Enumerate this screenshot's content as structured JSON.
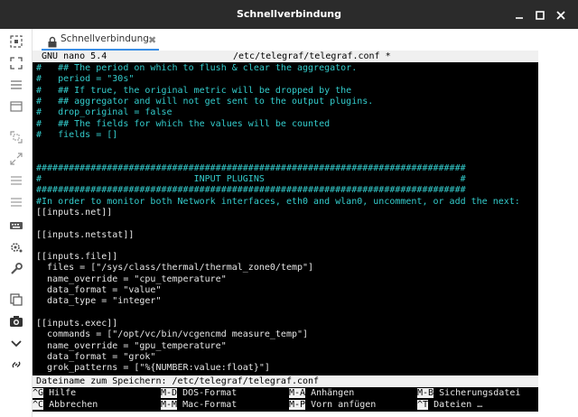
{
  "window": {
    "title": "Schnellverbindung",
    "min_symbol": "–",
    "max_symbol": "□",
    "close_symbol": "✕"
  },
  "sidebar": {
    "icons": [
      "select-icon",
      "fullscreen-icon",
      "menu-icon",
      "window-icon",
      "resize-icon",
      "expand-icon",
      "list-icon",
      "list-icon",
      "keyboard-icon",
      "settings-icon",
      "wrench-icon",
      "copy-icon",
      "camera-icon",
      "chevron-down-icon",
      "link-icon"
    ]
  },
  "tab": {
    "label": "Schnellverbindung",
    "close_symbol": "✖"
  },
  "nano": {
    "version": "GNU nano 5.4",
    "filename": "/etc/telegraf/telegraf.conf *"
  },
  "lines": [
    {
      "text": "#   ## The period on which to flush & clear the aggregator.",
      "type": "comment"
    },
    {
      "text": "#   period = \"30s\"",
      "type": "comment"
    },
    {
      "text": "#   ## If true, the original metric will be dropped by the",
      "type": "comment"
    },
    {
      "text": "#   ## aggregator and will not get sent to the output plugins.",
      "type": "comment"
    },
    {
      "text": "#   drop_original = false",
      "type": "comment"
    },
    {
      "text": "#   ## The fields for which the values will be counted",
      "type": "comment"
    },
    {
      "text": "#   fields = []",
      "type": "comment"
    },
    {
      "text": "",
      "type": "plain"
    },
    {
      "text": "",
      "type": "plain"
    },
    {
      "text": "###############################################################################",
      "type": "comment"
    },
    {
      "text": "#                            INPUT PLUGINS                                    #",
      "type": "comment"
    },
    {
      "text": "###############################################################################",
      "type": "comment"
    },
    {
      "text": "#In order to monitor both Network interfaces, eth0 and wlan0, uncomment, or add the next:",
      "type": "comment"
    },
    {
      "text": "[[inputs.net]]",
      "type": "plain"
    },
    {
      "text": "",
      "type": "plain"
    },
    {
      "text": "[[inputs.netstat]]",
      "type": "plain"
    },
    {
      "text": "",
      "type": "plain"
    },
    {
      "text": "[[inputs.file]]",
      "type": "plain"
    },
    {
      "text": "  files = [\"/sys/class/thermal/thermal_zone0/temp\"]",
      "type": "plain"
    },
    {
      "text": "  name_override = \"cpu_temperature\"",
      "type": "plain"
    },
    {
      "text": "  data_format = \"value\"",
      "type": "plain"
    },
    {
      "text": "  data_type = \"integer\"",
      "type": "plain"
    },
    {
      "text": "",
      "type": "plain"
    },
    {
      "text": "[[inputs.exec]]",
      "type": "plain"
    },
    {
      "text": "  commands = [\"/opt/vc/bin/vcgencmd measure_temp\"]",
      "type": "plain"
    },
    {
      "text": "  name_override = \"gpu_temperature\"",
      "type": "plain"
    },
    {
      "text": "  data_format = \"grok\"",
      "type": "plain"
    },
    {
      "text": "  grok_patterns = [\"%{NUMBER:value:float}\"]",
      "type": "plain"
    }
  ],
  "prompt": "Dateiname zum Speichern: /etc/telegraf/telegraf.conf",
  "shortcuts": [
    {
      "key": "^G",
      "label": " Hilfe"
    },
    {
      "key": "M-D",
      "label": " DOS-Format"
    },
    {
      "key": "M-A",
      "label": " Anhängen"
    },
    {
      "key": "M-B",
      "label": " Sicherungsdatei"
    },
    {
      "key": "^C",
      "label": " Abbrechen"
    },
    {
      "key": "M-M",
      "label": " Mac-Format"
    },
    {
      "key": "M-P",
      "label": " Vorn anfügen"
    },
    {
      "key": "^T",
      "label": " Dateien …"
    }
  ]
}
